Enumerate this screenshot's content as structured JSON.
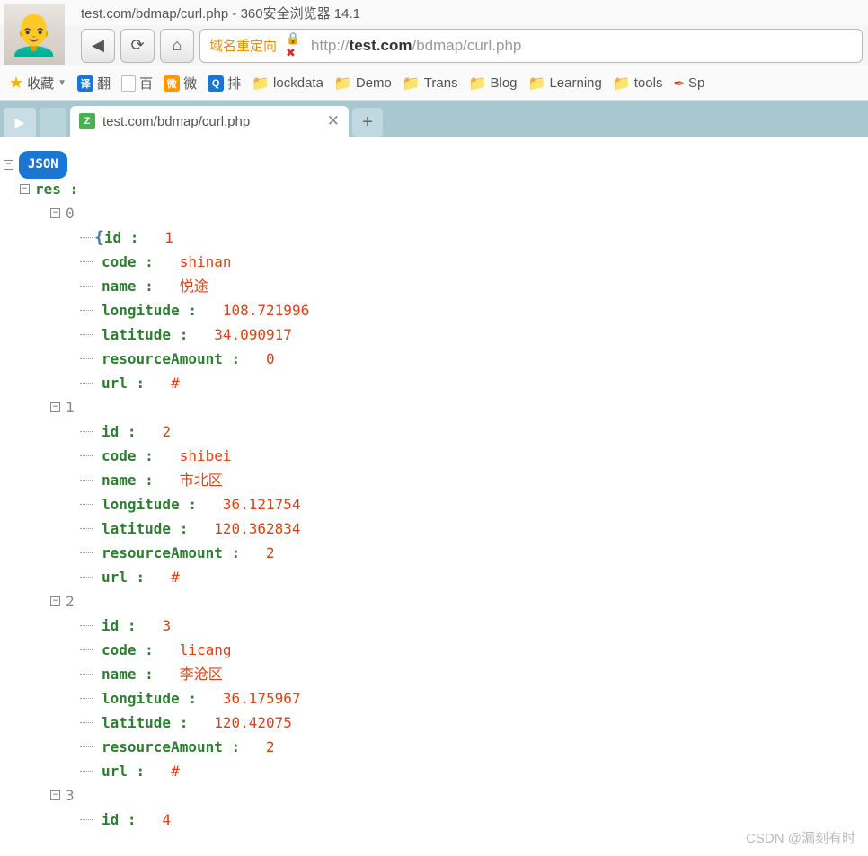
{
  "window": {
    "title": "test.com/bdmap/curl.php - 360安全浏览器 14.1"
  },
  "addressbar": {
    "redirect_label": "域名重定向",
    "url_prefix": "http://",
    "url_host": "test.com",
    "url_path": "/bdmap/curl.php"
  },
  "bookmarks": {
    "fav": "收藏",
    "translate": "翻",
    "bai": "百",
    "wei": "微",
    "rank": "排",
    "items": [
      "lockdata",
      "Demo",
      "Trans",
      "Blog",
      "Learning",
      "tools",
      "Sp"
    ]
  },
  "tab": {
    "title": "test.com/bdmap/curl.php"
  },
  "json_view": {
    "badge": "JSON",
    "root_key": "res",
    "items": [
      {
        "index": "0",
        "id": "1",
        "code": "shinan",
        "name": "悦途",
        "longitude": "108.721996",
        "latitude": "34.090917",
        "resourceAmount": "0",
        "url": "#"
      },
      {
        "index": "1",
        "id": "2",
        "code": "shibei",
        "name": "市北区",
        "longitude": "36.121754",
        "latitude": "120.362834",
        "resourceAmount": "2",
        "url": "#"
      },
      {
        "index": "2",
        "id": "3",
        "code": "licang",
        "name": "李沧区",
        "longitude": "36.175967",
        "latitude": "120.42075",
        "resourceAmount": "2",
        "url": "#"
      },
      {
        "index": "3",
        "id": "4"
      }
    ],
    "labels": {
      "id": "id",
      "code": "code",
      "name": "name",
      "longitude": "longitude",
      "latitude": "latitude",
      "resourceAmount": "resourceAmount",
      "url": "url"
    }
  },
  "watermark": "CSDN @漏刻有时"
}
